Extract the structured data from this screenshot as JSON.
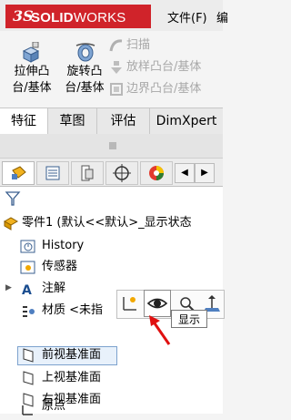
{
  "app": {
    "logo_ds": "3S",
    "logo_brand_bold": "SOLID",
    "logo_brand_rest": "WORKS",
    "menu": [
      "文件(F)",
      "编"
    ]
  },
  "commands": {
    "extrude_line1": "拉伸凸",
    "extrude_line2": "台/基体",
    "revolve_line1": "旋转凸",
    "revolve_line2": "台/基体",
    "sweep": "扫描",
    "loft": "放样凸台/基体",
    "boundary": "边界凸台/基体"
  },
  "tabs": [
    "特征",
    "草图",
    "评估",
    "DimXpert"
  ],
  "active_tab_index": 0,
  "tree": {
    "root": "零件1 (默认<<默认>_显示状态",
    "items": [
      {
        "label": "History",
        "icon": "history-icon"
      },
      {
        "label": "传感器",
        "icon": "sensor-icon"
      },
      {
        "label": "注解",
        "icon": "annotation-icon",
        "expandable": true
      },
      {
        "label": "材质 <未指",
        "icon": "material-icon"
      },
      {
        "label": "前视基准面",
        "icon": "plane-icon",
        "selected": true
      },
      {
        "label": "上视基准面",
        "icon": "plane-icon"
      },
      {
        "label": "右视基准面",
        "icon": "plane-icon"
      },
      {
        "label": "原点",
        "icon": "origin-icon"
      }
    ]
  },
  "context_popup": {
    "tooltip": "显示",
    "buttons": [
      "edit-sketch-icon",
      "show-eye-icon",
      "zoom-icon",
      "normal-to-icon"
    ]
  },
  "colors": {
    "brand_red": "#d0232a",
    "selection_bg": "#e8f1fb",
    "selection_border": "#7da2ce",
    "arrow_red": "#e01010"
  }
}
